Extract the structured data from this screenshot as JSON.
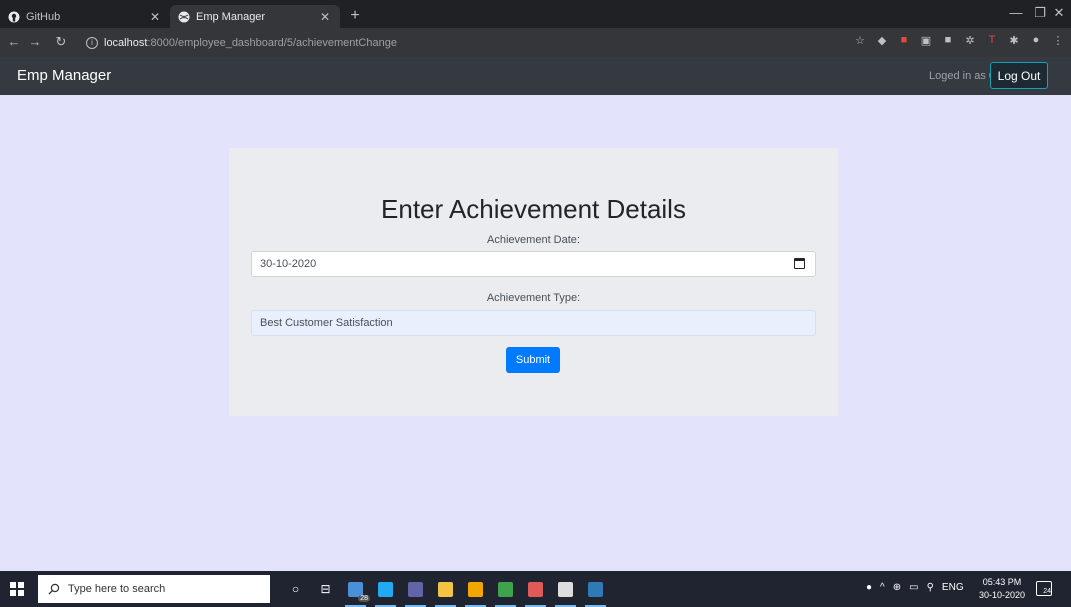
{
  "browser": {
    "tabs": [
      {
        "label": "GitHub",
        "icon": "github-icon",
        "active": false
      },
      {
        "label": "Emp Manager",
        "icon": "globe-icon",
        "active": true
      }
    ],
    "url_host": "localhost",
    "url_rest": ":8000/employee_dashboard/5/achievementChange"
  },
  "nav": {
    "brand": "Emp Manager",
    "logged_in": "Loged in as 0",
    "logout_label": "Log Out"
  },
  "form": {
    "title": "Enter Achievement Details",
    "date_label": "Achievement Date:",
    "date_value": "30-10-2020",
    "type_label": "Achievement Type:",
    "type_value": "Best Customer Satisfaction",
    "submit_label": "Submit"
  },
  "taskbar": {
    "search_placeholder": "Type here to search",
    "apps": [
      {
        "name": "cortana-icon",
        "color": "#ffffff"
      },
      {
        "name": "task-view-icon",
        "color": "#ffffff"
      },
      {
        "name": "mail-icon",
        "color": "#4a90d9",
        "badge": "28"
      },
      {
        "name": "vscode-icon",
        "color": "#23a9f2"
      },
      {
        "name": "teams-icon",
        "color": "#6264a7"
      },
      {
        "name": "file-explorer-icon",
        "color": "#f3c443"
      },
      {
        "name": "chrome-icon",
        "color": "#f2a600"
      },
      {
        "name": "app-green-icon",
        "color": "#3fa34d"
      },
      {
        "name": "app-red-icon",
        "color": "#e05a5a"
      },
      {
        "name": "settings-gear-icon",
        "color": "#dddddd"
      },
      {
        "name": "app-blue-icon",
        "color": "#2f79b6"
      }
    ],
    "language": "ENG",
    "time": "05:43 PM",
    "date": "30-10-2020",
    "notification_count": "24"
  }
}
